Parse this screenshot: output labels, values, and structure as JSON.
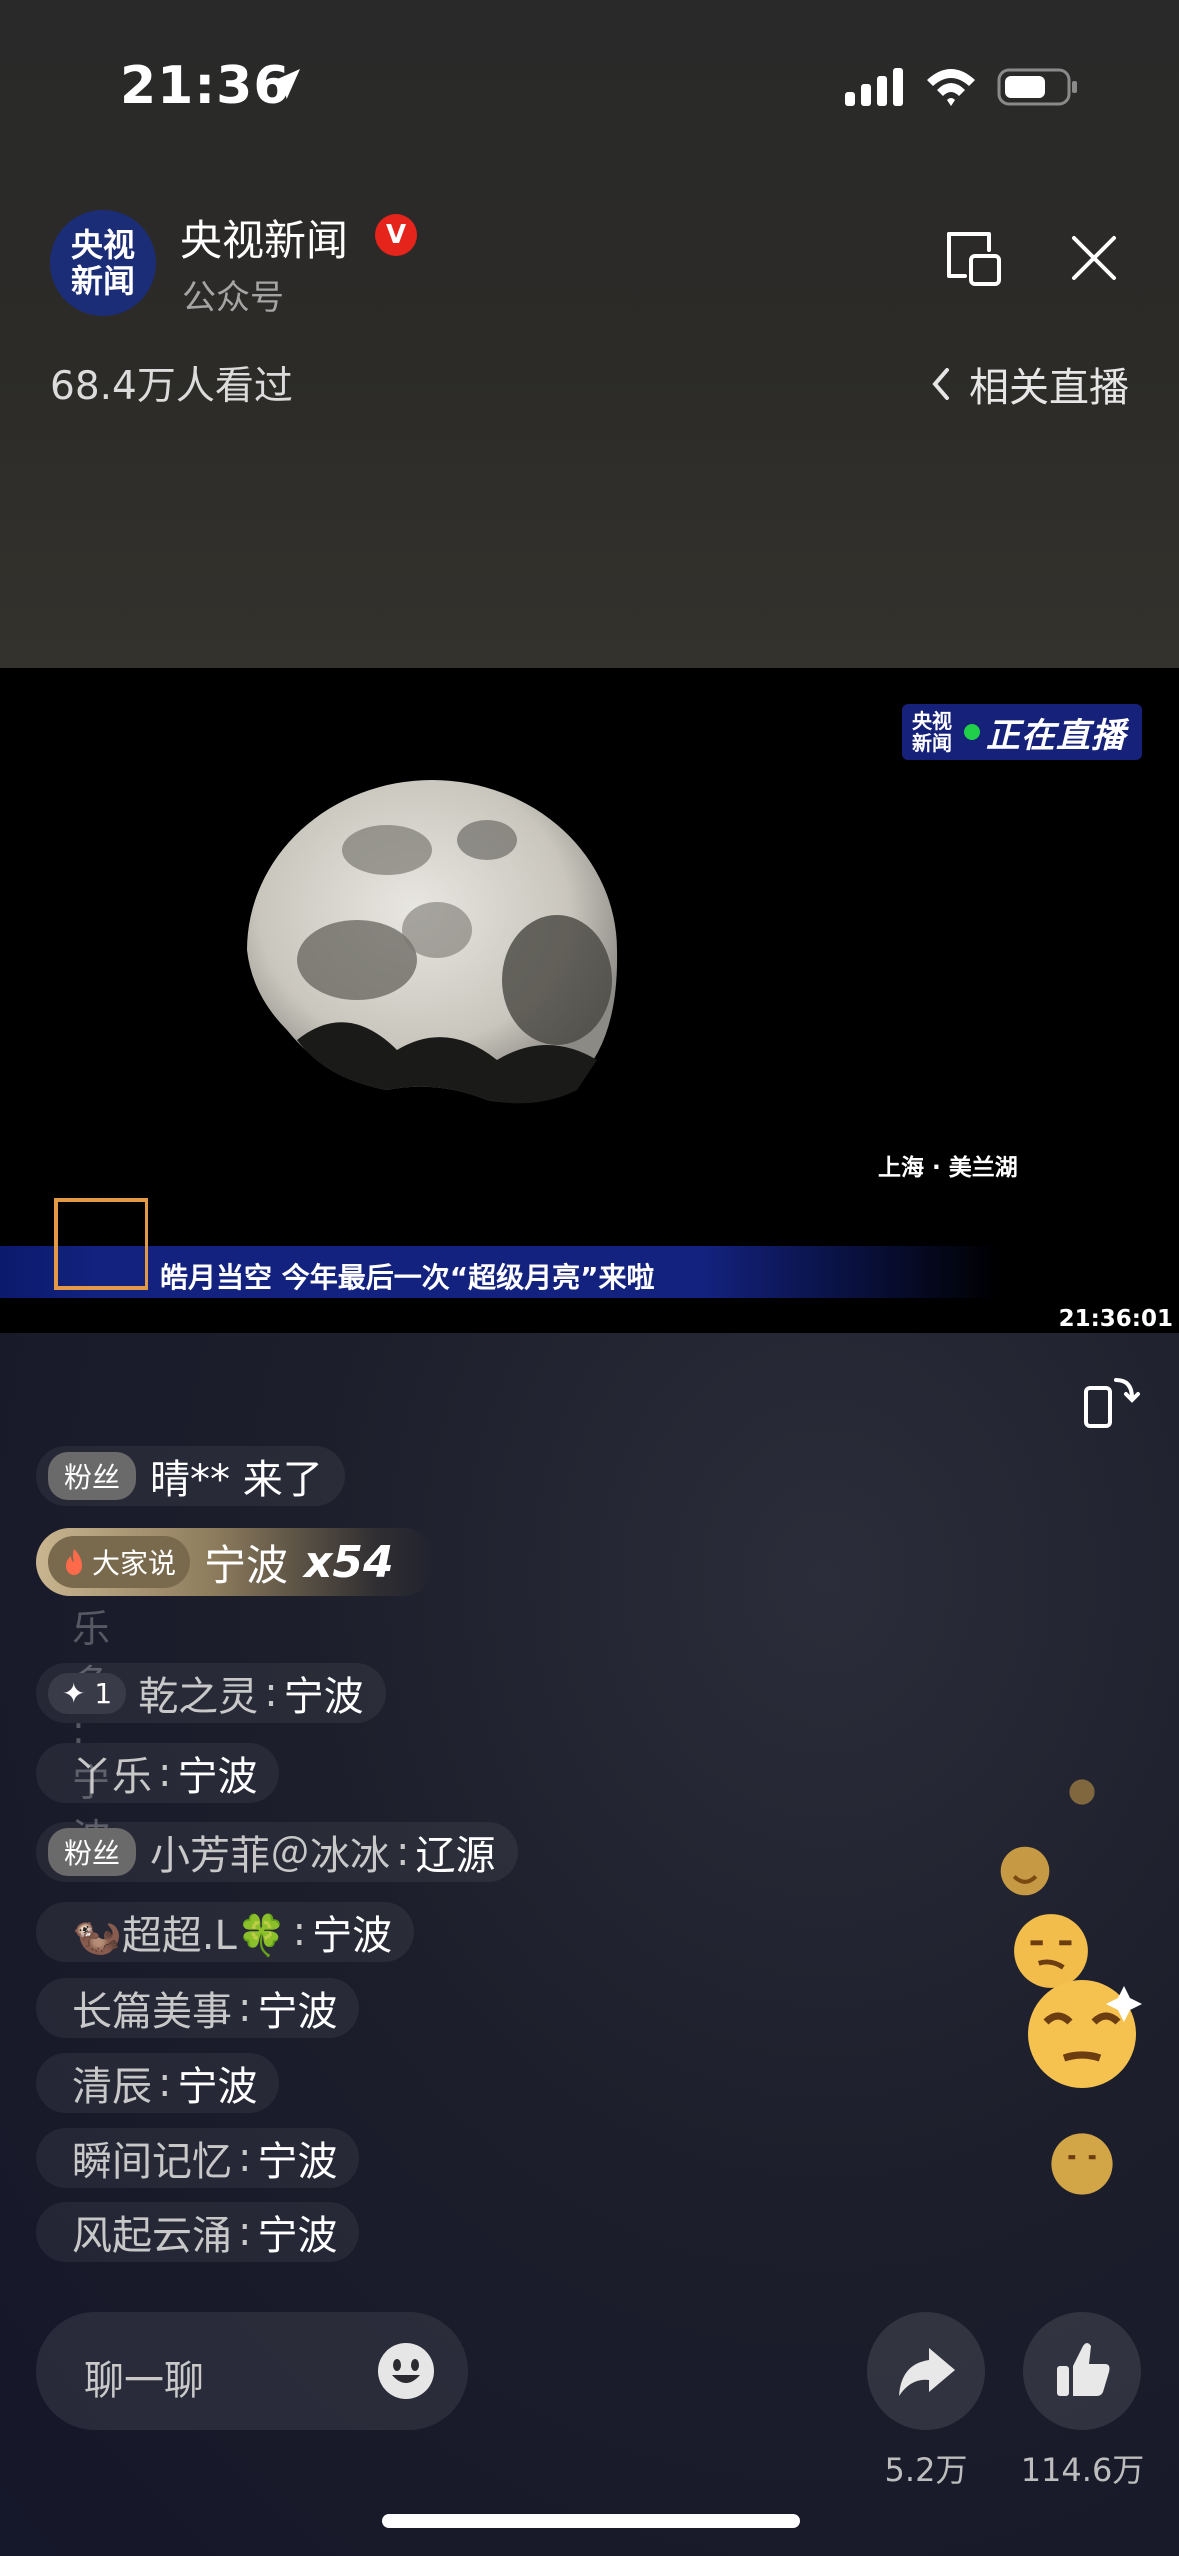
{
  "status_bar": {
    "time": "21:36"
  },
  "header": {
    "logo_line1": "央视",
    "logo_line2": "新闻",
    "channel_name": "央视新闻",
    "verified_mark": "V",
    "channel_type": "公众号",
    "views": "68.4万人看过",
    "related_live": "相关直播"
  },
  "video": {
    "badge_logo_line1": "央视",
    "badge_logo_line2": "新闻",
    "badge_live": "正在直播",
    "location": "上海 · 美兰湖",
    "headline": "皓月当空 今年最后一次“超级月亮”来啦",
    "clock": "21:36:01"
  },
  "chat": {
    "entry": {
      "badge": "粉丝",
      "text": "晴** 来了"
    },
    "highlight": {
      "tag": "大家说",
      "message": "宁波",
      "count": "x54"
    },
    "faded": "乐多 : 宁波",
    "messages": [
      {
        "badge": "✦ 1",
        "user": "乾之灵",
        "text": "宁波"
      },
      {
        "user": "丫乐",
        "text": "宁波"
      },
      {
        "badge": "粉丝",
        "user": "小芳菲＠冰冰",
        "text": "辽源"
      },
      {
        "user": "🦦超超.L🍀",
        "text": "宁波"
      },
      {
        "user": "长篇美事",
        "text": "宁波"
      },
      {
        "user": "清辰",
        "text": "宁波"
      },
      {
        "user": "瞬间记忆",
        "text": "宁波"
      },
      {
        "user": "风起云涌",
        "text": "宁波"
      }
    ]
  },
  "bottom_bar": {
    "chat_placeholder": "聊一聊",
    "share_count": "5.2万",
    "like_count": "114.6万"
  }
}
